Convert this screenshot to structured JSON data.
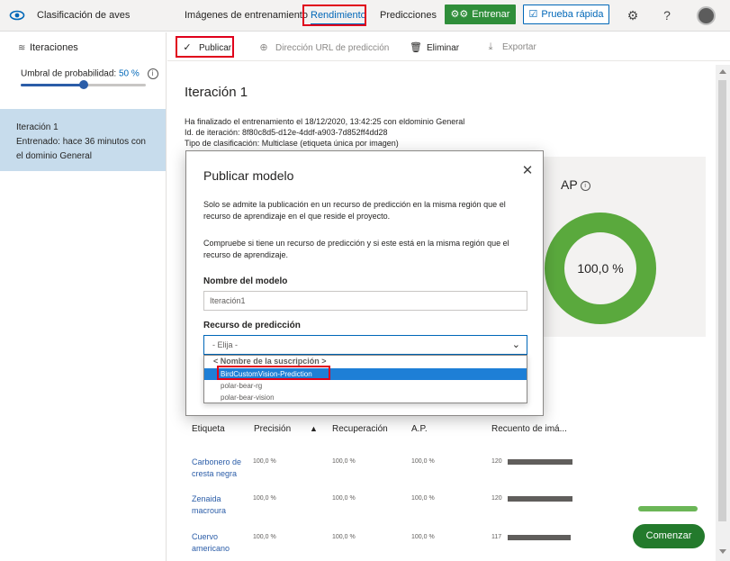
{
  "topbar": {
    "app_title": "Clasificación de aves",
    "tabs": [
      "Imágenes de entrenamiento",
      "Rendimiento",
      "Predicciones"
    ],
    "active_tab": "Rendimiento",
    "train_label": "Entrenar",
    "quick_test_label": "Prueba rápida",
    "icons": [
      "eye-icon",
      "gear-icon",
      "help-icon",
      "avatar"
    ]
  },
  "sidebar": {
    "iterations_heading": "Iteraciones",
    "threshold_label": "Umbral de probabilidad:",
    "threshold_value": "50 %",
    "threshold_fraction": 0.5,
    "iteration_item": {
      "name": "Iteración 1",
      "trained_line1": "Entrenado: hace 36 minutos con",
      "trained_line2": "el dominio General"
    }
  },
  "commands": {
    "publish": "Publicar",
    "prediction_url": "Dirección URL de predicción",
    "delete": "Eliminar",
    "export": "Exportar"
  },
  "iteration": {
    "title": "Iteración 1",
    "meta_line1_prefix": "Ha finalizado el entrenamiento el 18/12/2020, 13:42:25 con eldominio ",
    "meta_line1_domain": "General",
    "meta_line2_prefix": "Id. de iteración: ",
    "meta_line2_value": "8f80c8d5-d12e-4ddf-a903-7d852ff4dd28",
    "meta_line3_prefix": "Tipo de clasificación: ",
    "meta_line3_value": "Multiclase (etiqueta única por imagen)"
  },
  "ap_card": {
    "title": "AP",
    "value": "100,0 %",
    "fraction": 1.0,
    "color": "#5aa93d"
  },
  "table": {
    "headers": [
      "Etiqueta",
      "Precisión",
      "Recuperación",
      "A.P.",
      "Recuento de imá..."
    ],
    "rows": [
      {
        "label_line1": "Carbonero de",
        "label_line2": "cresta negra",
        "precision": "100,0 %",
        "recall": "100,0 %",
        "ap": "100,0 %",
        "count": "120",
        "count_value": 120
      },
      {
        "label_line1": "Zenaida",
        "label_line2": "macroura",
        "precision": "100,0 %",
        "recall": "100,0 %",
        "ap": "100,0 %",
        "count": "120",
        "count_value": 120
      },
      {
        "label_line1": "Cuervo",
        "label_line2": "americano",
        "precision": "100,0 %",
        "recall": "100,0 %",
        "ap": "100,0 %",
        "count": "117",
        "count_value": 117
      }
    ]
  },
  "start_button": "Comenzar",
  "modal": {
    "title": "Publicar modelo",
    "para1_line1": "Solo se admite la publicación en un recurso de predicción en la misma región que el",
    "para1_line2": "recurso de aprendizaje en el que reside el proyecto.",
    "para2_line1": "Compruebe si tiene un recurso de predicción y si este está en la misma región que el",
    "para2_line2": "recurso de aprendizaje.",
    "model_name_label": "Nombre del modelo",
    "model_name_value": "Iteración1",
    "resource_label": "Recurso de predicción",
    "resource_selected": "- Elija -",
    "dropdown_group": "< Nombre de la suscripción >",
    "options": [
      "BirdCustomVision-Prediction",
      "polar-bear-rg",
      "polar-bear-vision"
    ],
    "highlighted_option": "BirdCustomVision-Prediction"
  }
}
